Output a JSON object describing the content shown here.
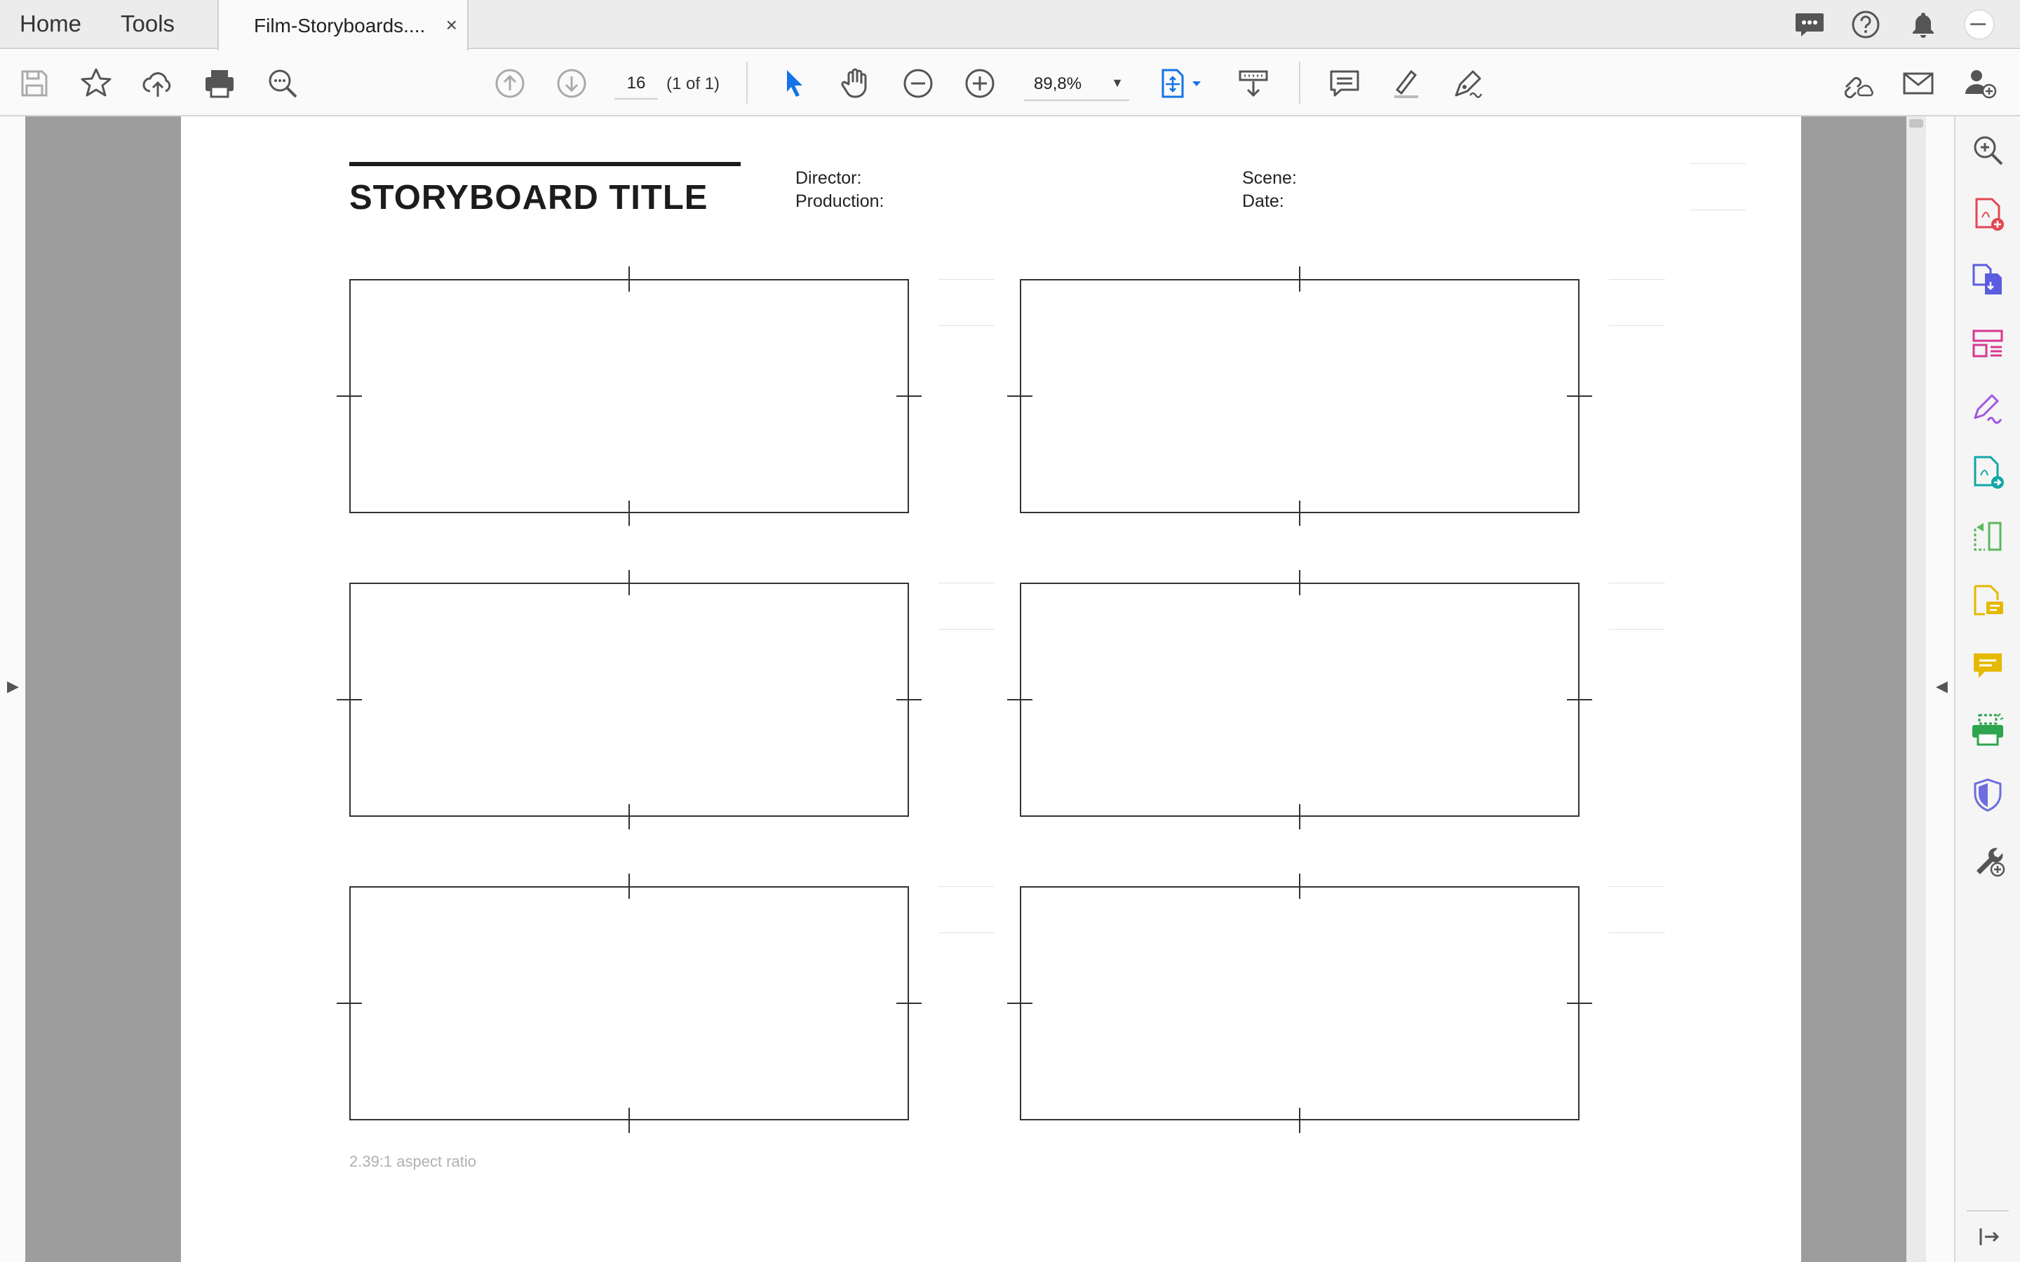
{
  "tabs": {
    "home": "Home",
    "tools": "Tools",
    "document": "Film-Storyboards....",
    "close": "×"
  },
  "toolbar": {
    "page_number": "16",
    "page_of": "(1 of 1)",
    "zoom": "89,8%"
  },
  "document": {
    "title": "STORYBOARD TITLE",
    "director_label": "Director:",
    "production_label": "Production:",
    "scene_label": "Scene:",
    "date_label": "Date:",
    "aspect_note": "2.39:1 aspect ratio",
    "frames_count_label": ""
  },
  "colors": {
    "accent_blue": "#1473e6",
    "create_pdf_red": "#e34850",
    "combine_blue": "#5c5ce0",
    "organize_pink": "#d83790",
    "fill_sign_purple": "#9f56e0",
    "export_teal": "#12a6a6",
    "compare_green": "#5cb85c",
    "comment_yellow": "#e6b800",
    "protect_indigo": "#6d6de0"
  },
  "icons": {
    "save": "save-icon",
    "bookmark": "star-icon",
    "upload": "cloud-upload-icon",
    "print": "print-icon",
    "search": "search-zoom-icon",
    "prev": "arrow-up-circle-icon",
    "next": "arrow-down-circle-icon",
    "select": "pointer-icon",
    "hand": "hand-icon",
    "zoom_out": "zoom-out-icon",
    "zoom_in": "zoom-in-icon"
  }
}
